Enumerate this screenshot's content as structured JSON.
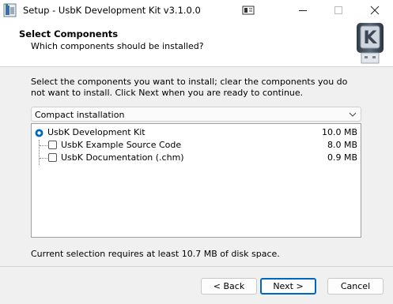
{
  "window": {
    "title": "Setup - UsbK Development Kit v3.1.0.0"
  },
  "header": {
    "title": "Select Components",
    "subtitle": "Which components should be installed?",
    "logo_letter": "K"
  },
  "main": {
    "instructions": "Select the components you want to install; clear the components you do not want to install. Click Next when you are ready to continue.",
    "install_type": {
      "selected": "Compact installation"
    },
    "components": [
      {
        "label": "UsbK Development Kit",
        "size": "10.0 MB",
        "type": "radio",
        "checked": true
      },
      {
        "label": "UsbK Example Source Code",
        "size": "8.0 MB",
        "type": "checkbox",
        "checked": false
      },
      {
        "label": "UsbK Documentation (.chm)",
        "size": "0.9 MB",
        "type": "checkbox",
        "checked": false
      }
    ],
    "disk_space": "Current selection requires at least 10.7 MB of disk space."
  },
  "buttons": {
    "back": "< Back",
    "next": "Next >",
    "cancel": "Cancel"
  },
  "colors": {
    "accent": "#0067c0",
    "panel": "#f0f0f0"
  }
}
